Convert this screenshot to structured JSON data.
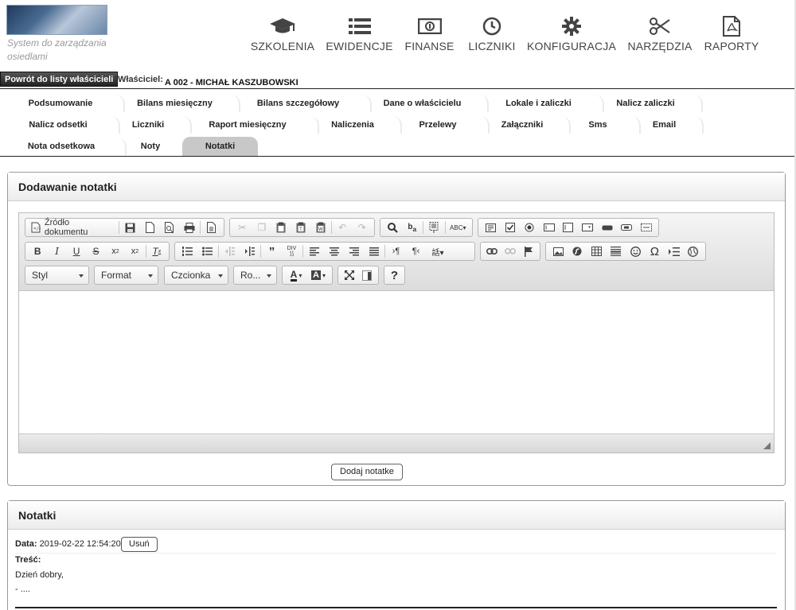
{
  "header": {
    "logo_text": "System do zarządzania osiedlami",
    "nav": [
      {
        "label": "SZKOLENIA",
        "icon": "graduation-cap-icon"
      },
      {
        "label": "EWIDENCJE",
        "icon": "list-icon"
      },
      {
        "label": "FINANSE",
        "icon": "money-icon"
      },
      {
        "label": "LICZNIKI",
        "icon": "clock-icon"
      },
      {
        "label": "KONFIGURACJA",
        "icon": "gear-icon"
      },
      {
        "label": "NARZĘDZIA",
        "icon": "scissors-icon"
      },
      {
        "label": "RAPORTY",
        "icon": "pdf-icon"
      }
    ]
  },
  "owner_bar": {
    "back_label": "Powrót do listy właścicieli",
    "owner_label": "Właściciel:",
    "owner_value": "A 002 - MICHAŁ KASZUBOWSKI"
  },
  "tabs": [
    [
      "Podsumowanie",
      "Bilans miesięczny",
      "Bilans szczegółowy",
      "Dane o właścicielu",
      "Lokale i zaliczki",
      "Nalicz zaliczki"
    ],
    [
      "Nalicz odsetki",
      "Liczniki",
      "Raport miesięczny",
      "Naliczenia",
      "Przelewy",
      "Załączniki",
      "Sms",
      "Email"
    ],
    [
      "Nota odsetkowa",
      "Noty",
      "Notatki"
    ]
  ],
  "active_tab": "Notatki",
  "add_note": {
    "title": "Dodawanie notatki",
    "toolbar": {
      "source_label": "Źródło dokumentu",
      "style_label": "Styl",
      "format_label": "Format",
      "font_label": "Czcionka",
      "size_label": "Ro...",
      "help_label": "?"
    },
    "submit_label": "Dodaj notatke"
  },
  "notes": {
    "title": "Notatki",
    "items": [
      {
        "date_label": "Data:",
        "date_value": "2019-02-22 12:54:20",
        "delete_label": "Usuń",
        "content_label": "Treść:",
        "content_line1": "Dzień dobry,",
        "content_line2": "- ...."
      }
    ]
  }
}
